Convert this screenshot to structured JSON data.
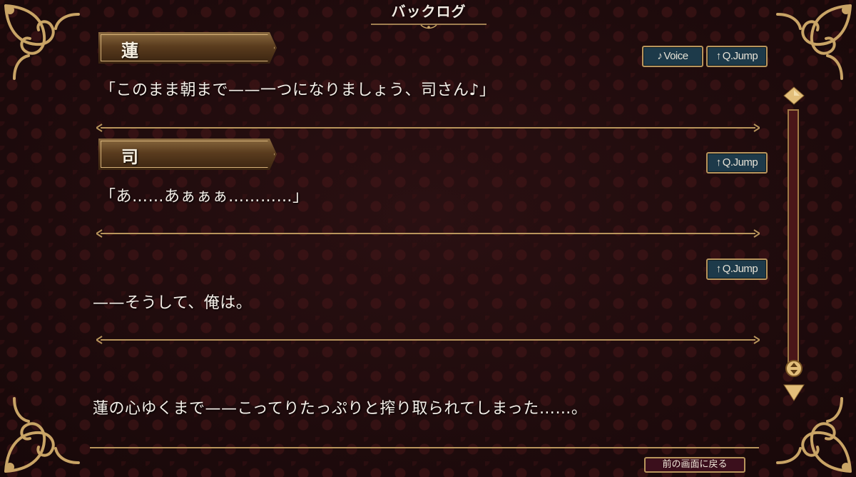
{
  "title": "バックログ",
  "entries": [
    {
      "speaker": "蓮",
      "text": "「このまま朝まで——一つになりましょう、司さん♪」",
      "buttons": {
        "voice": "Voice",
        "jump": "Q.Jump"
      }
    },
    {
      "speaker": "司",
      "text": "「あ……あぁぁぁ…………」",
      "buttons": {
        "jump": "Q.Jump"
      }
    },
    {
      "speaker": "",
      "text": "——そうして、俺は。",
      "buttons": {
        "jump": "Q.Jump"
      }
    },
    {
      "speaker": "",
      "text": "蓮の心ゆくまで——こってりたっぷりと搾り取られてしまった……。"
    }
  ],
  "icons": {
    "voice": "music-note-icon",
    "jump": "up-arrow-icon"
  },
  "footer": {
    "back_label": "前の画面に戻る"
  },
  "colors": {
    "gold": "#b8955c",
    "button_blue": "#1d3a4a",
    "background": "#1b0b0c",
    "scroll_red": "#4a1618"
  }
}
